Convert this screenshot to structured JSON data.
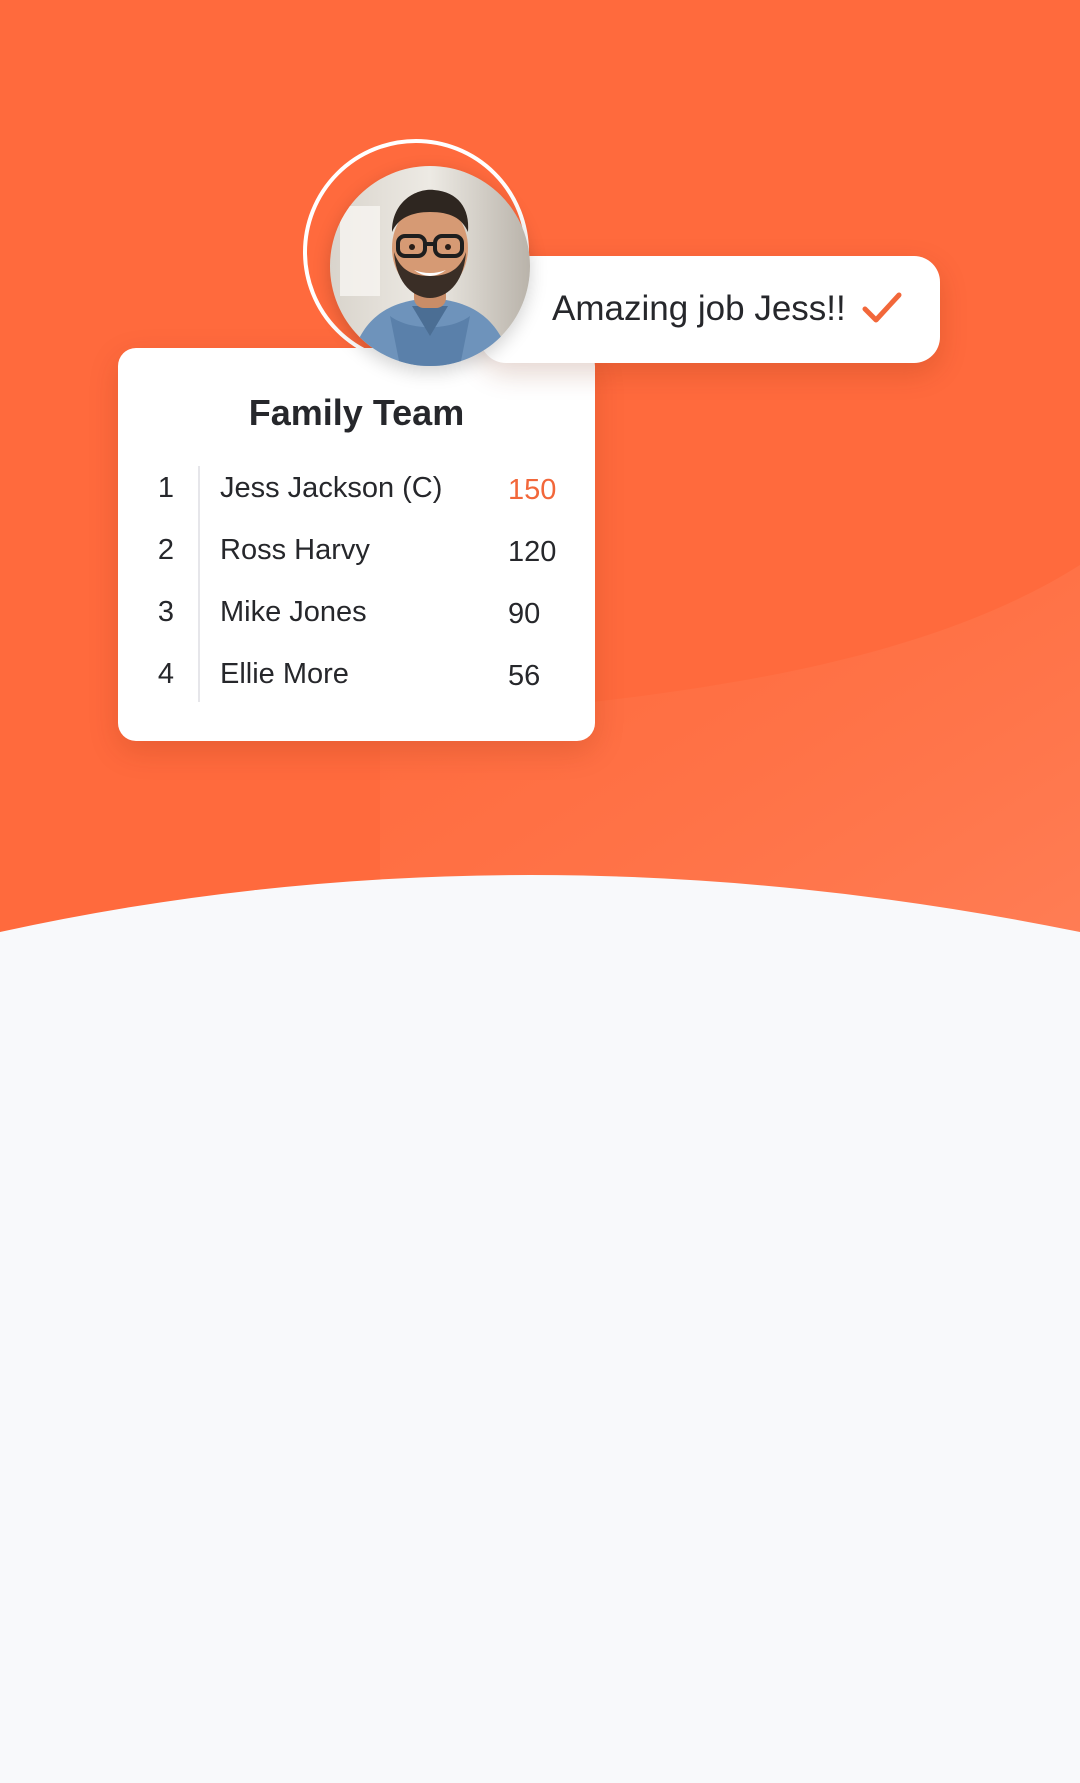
{
  "colors": {
    "hero_orange": "#FF6A3D",
    "accent_orange": "#F2673A",
    "page_background": "#F8F9FB",
    "card_background": "#FFFFFF",
    "text_dark": "#26272B"
  },
  "toast": {
    "message": "Amazing job Jess!!",
    "icon": "checkmark-icon"
  },
  "avatar": {
    "icon": "avatar-photo"
  },
  "leaderboard": {
    "title": "Family Team",
    "rows": [
      {
        "rank": "1",
        "name": "Jess Jackson (C)",
        "score": "150",
        "highlighted": true
      },
      {
        "rank": "2",
        "name": "Ross Harvy",
        "score": "120",
        "highlighted": false
      },
      {
        "rank": "3",
        "name": "Mike Jones",
        "score": "90",
        "highlighted": false
      },
      {
        "rank": "4",
        "name": "Ellie More",
        "score": "56",
        "highlighted": false
      }
    ]
  }
}
